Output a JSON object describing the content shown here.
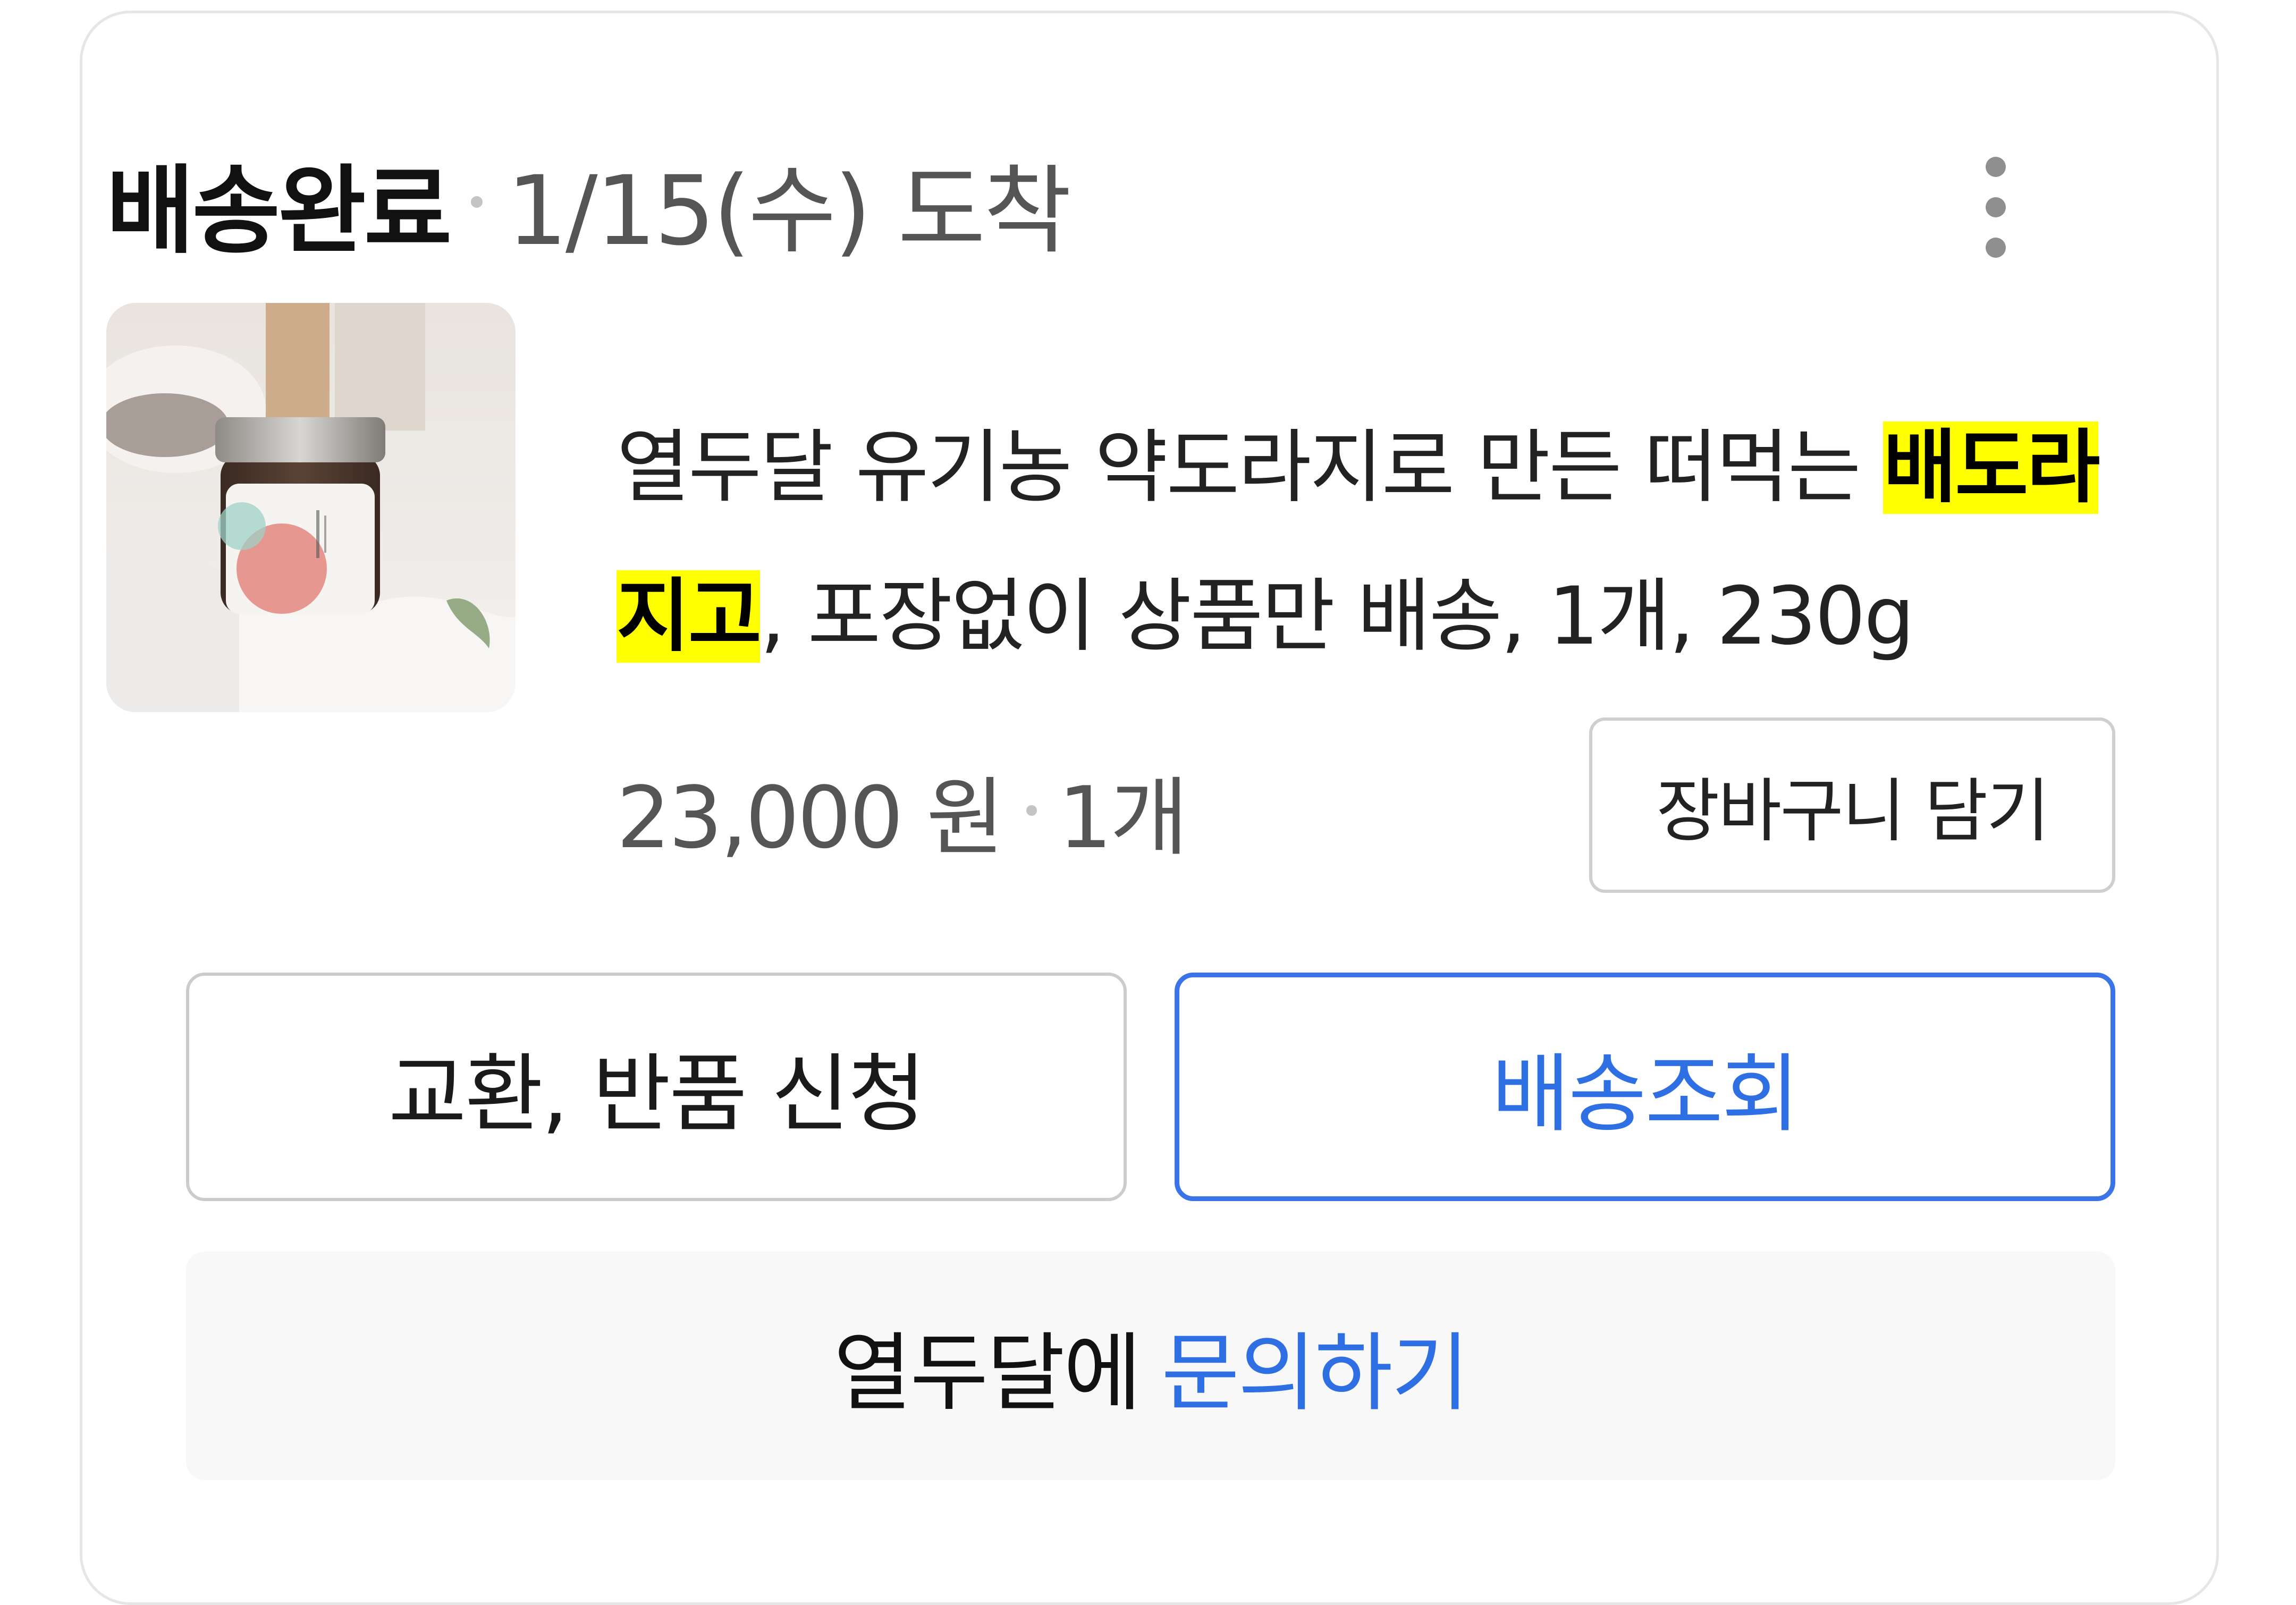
{
  "order": {
    "status": "배송완료",
    "arrival": "1/15(수) 도착",
    "more_icon": "more-vertical-icon"
  },
  "product": {
    "title_part1": "열두달 유기농 약도라지로 만든 떠먹는 ",
    "title_highlight": "배도라지고",
    "title_part2": ", 포장없이 상품만 배송, 1개, 230g",
    "price": "23,000 원",
    "quantity": "1개",
    "cart_button_label": "장바구니 담기",
    "highlight_color": "#ffff00"
  },
  "actions": {
    "exchange_return_label": "교환, 반품 신청",
    "track_delivery_label": "배송조회",
    "accent_color": "#2f6fe4"
  },
  "inquiry": {
    "seller": "열두달에",
    "link_label": "문의하기"
  }
}
